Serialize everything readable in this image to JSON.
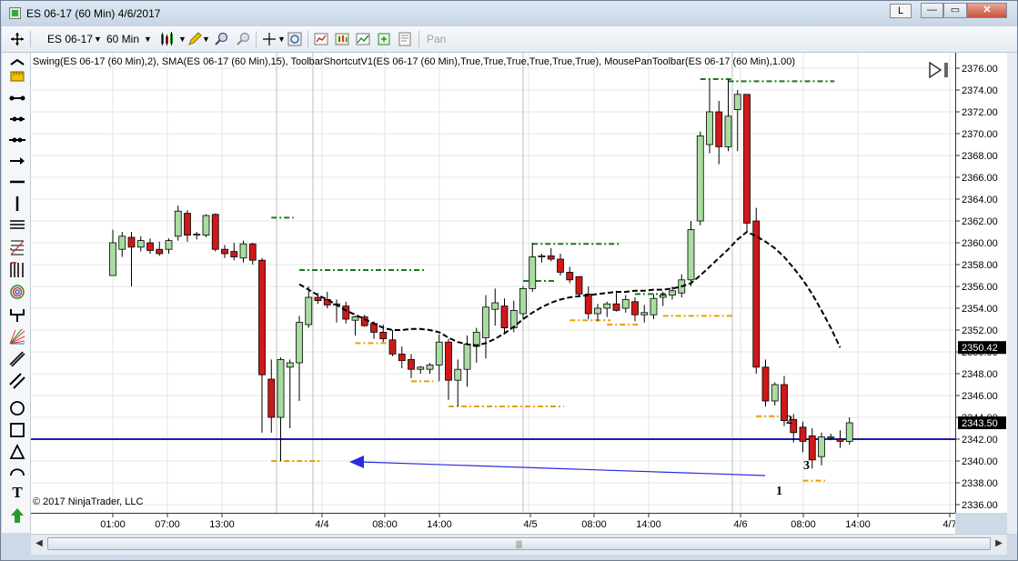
{
  "window": {
    "title": "ES 06-17 (60 Min)  4/6/2017",
    "layout_button": "L",
    "minimize": "—",
    "maximize": "▭",
    "close": "✕"
  },
  "toolbar": {
    "instrument": "ES 06-17",
    "interval": "60 Min",
    "pan_label": "Pan"
  },
  "chart_header": {
    "indicators": "Swing(ES 06-17 (60 Min),2), SMA(ES 06-17 (60 Min),15), ToolbarShortcutV1(ES 06-17 (60 Min),True,True,True,True,True,True), MousePanToolbar(ES 06-17 (60 Min),1.00)",
    "copyright": "© 2017 NinjaTrader, LLC"
  },
  "price_axis": {
    "ticks": [
      "2376.00",
      "2374.00",
      "2372.00",
      "2370.00",
      "2368.00",
      "2366.00",
      "2364.00",
      "2362.00",
      "2360.00",
      "2358.00",
      "2356.00",
      "2354.00",
      "2352.00",
      "2350.00",
      "2348.00",
      "2346.00",
      "2344.00",
      "2342.00",
      "2340.00",
      "2338.00",
      "2336.00"
    ],
    "current_price_label": "2350.42",
    "hline_label": "2343.50"
  },
  "time_axis": {
    "labels": [
      "01:00",
      "07:00",
      "13:00",
      "4/4",
      "08:00",
      "14:00",
      "4/5",
      "08:00",
      "14:00",
      "4/6",
      "08:00",
      "14:00",
      "4/7"
    ]
  },
  "annotations": {
    "label_1": "1",
    "label_2": "2",
    "label_3": "3"
  },
  "colors": {
    "up_candle": "#a8dca0",
    "down_candle": "#d01818",
    "sma": "#000000",
    "swing_high": "#1a7a1a",
    "swing_low": "#e8a000",
    "hline": "#1c1ca8",
    "arrow": "#2a2ae0"
  },
  "chart_data": {
    "type": "candlestick",
    "instrument": "ES 06-17",
    "interval": "60 Min",
    "ylim": [
      2336,
      2377
    ],
    "candles": [
      {
        "o": 2357.0,
        "h": 2361.2,
        "l": 2357.0,
        "c": 2360.0
      },
      {
        "o": 2359.4,
        "h": 2361.0,
        "l": 2358.7,
        "c": 2360.6
      },
      {
        "o": 2360.5,
        "h": 2361.0,
        "l": 2356.0,
        "c": 2359.6
      },
      {
        "o": 2359.6,
        "h": 2360.6,
        "l": 2359.2,
        "c": 2360.2
      },
      {
        "o": 2360.0,
        "h": 2360.4,
        "l": 2359.0,
        "c": 2359.3
      },
      {
        "o": 2359.4,
        "h": 2360.1,
        "l": 2358.8,
        "c": 2359.0
      },
      {
        "o": 2359.4,
        "h": 2360.4,
        "l": 2359.0,
        "c": 2360.2
      },
      {
        "o": 2360.6,
        "h": 2363.4,
        "l": 2360.2,
        "c": 2362.9
      },
      {
        "o": 2362.7,
        "h": 2363.0,
        "l": 2360.1,
        "c": 2360.7
      },
      {
        "o": 2360.7,
        "h": 2361.0,
        "l": 2360.3,
        "c": 2360.8
      },
      {
        "o": 2360.7,
        "h": 2362.6,
        "l": 2360.5,
        "c": 2362.5
      },
      {
        "o": 2362.6,
        "h": 2362.7,
        "l": 2359.2,
        "c": 2359.4
      },
      {
        "o": 2359.4,
        "h": 2359.8,
        "l": 2358.6,
        "c": 2359.0
      },
      {
        "o": 2359.2,
        "h": 2360.0,
        "l": 2358.4,
        "c": 2358.7
      },
      {
        "o": 2358.6,
        "h": 2360.2,
        "l": 2358.2,
        "c": 2359.9
      },
      {
        "o": 2359.9,
        "h": 2360.0,
        "l": 2358.0,
        "c": 2358.4
      },
      {
        "o": 2358.4,
        "h": 2358.6,
        "l": 2342.6,
        "c": 2347.9
      },
      {
        "o": 2347.5,
        "h": 2349.3,
        "l": 2342.6,
        "c": 2344.0
      },
      {
        "o": 2344.0,
        "h": 2349.5,
        "l": 2340.0,
        "c": 2349.3
      },
      {
        "o": 2348.6,
        "h": 2349.3,
        "l": 2343.0,
        "c": 2349.0
      },
      {
        "o": 2349.0,
        "h": 2353.3,
        "l": 2345.5,
        "c": 2352.7
      },
      {
        "o": 2352.5,
        "h": 2356.0,
        "l": 2352.2,
        "c": 2355.0
      },
      {
        "o": 2355.0,
        "h": 2355.4,
        "l": 2354.4,
        "c": 2354.7
      },
      {
        "o": 2354.8,
        "h": 2355.5,
        "l": 2354.0,
        "c": 2354.3
      },
      {
        "o": 2354.3,
        "h": 2354.8,
        "l": 2352.7,
        "c": 2354.4
      },
      {
        "o": 2354.2,
        "h": 2354.6,
        "l": 2352.6,
        "c": 2353.0
      },
      {
        "o": 2352.9,
        "h": 2353.3,
        "l": 2351.5,
        "c": 2353.2
      },
      {
        "o": 2353.2,
        "h": 2353.4,
        "l": 2352.3,
        "c": 2352.4
      },
      {
        "o": 2352.6,
        "h": 2352.8,
        "l": 2351.2,
        "c": 2351.8
      },
      {
        "o": 2351.8,
        "h": 2352.5,
        "l": 2350.9,
        "c": 2351.2
      },
      {
        "o": 2351.1,
        "h": 2352.0,
        "l": 2349.6,
        "c": 2349.8
      },
      {
        "o": 2349.8,
        "h": 2350.5,
        "l": 2348.5,
        "c": 2349.2
      },
      {
        "o": 2349.3,
        "h": 2349.8,
        "l": 2347.6,
        "c": 2348.4
      },
      {
        "o": 2348.4,
        "h": 2348.7,
        "l": 2348.0,
        "c": 2348.6
      },
      {
        "o": 2348.4,
        "h": 2349.0,
        "l": 2348.0,
        "c": 2348.8
      },
      {
        "o": 2348.8,
        "h": 2351.6,
        "l": 2347.3,
        "c": 2350.9
      },
      {
        "o": 2350.9,
        "h": 2351.2,
        "l": 2345.6,
        "c": 2347.4
      },
      {
        "o": 2347.4,
        "h": 2349.3,
        "l": 2345.0,
        "c": 2348.4
      },
      {
        "o": 2348.4,
        "h": 2351.5,
        "l": 2346.8,
        "c": 2350.7
      },
      {
        "o": 2350.5,
        "h": 2352.2,
        "l": 2349.0,
        "c": 2351.8
      },
      {
        "o": 2351.3,
        "h": 2355.2,
        "l": 2349.4,
        "c": 2354.1
      },
      {
        "o": 2353.9,
        "h": 2355.8,
        "l": 2352.4,
        "c": 2354.5
      },
      {
        "o": 2354.2,
        "h": 2354.9,
        "l": 2351.8,
        "c": 2352.2
      },
      {
        "o": 2352.2,
        "h": 2354.7,
        "l": 2351.8,
        "c": 2353.8
      },
      {
        "o": 2353.5,
        "h": 2356.0,
        "l": 2353.0,
        "c": 2355.8
      },
      {
        "o": 2355.8,
        "h": 2360.0,
        "l": 2355.5,
        "c": 2358.7
      },
      {
        "o": 2358.7,
        "h": 2359.0,
        "l": 2358.2,
        "c": 2358.8
      },
      {
        "o": 2358.8,
        "h": 2359.5,
        "l": 2358.3,
        "c": 2358.5
      },
      {
        "o": 2358.5,
        "h": 2359.0,
        "l": 2357.0,
        "c": 2357.3
      },
      {
        "o": 2357.3,
        "h": 2357.8,
        "l": 2356.3,
        "c": 2356.6
      },
      {
        "o": 2356.9,
        "h": 2356.6,
        "l": 2355.0,
        "c": 2355.3
      },
      {
        "o": 2355.3,
        "h": 2356.0,
        "l": 2353.0,
        "c": 2353.5
      },
      {
        "o": 2353.5,
        "h": 2354.4,
        "l": 2352.8,
        "c": 2354.0
      },
      {
        "o": 2354.0,
        "h": 2354.6,
        "l": 2353.2,
        "c": 2354.4
      },
      {
        "o": 2354.4,
        "h": 2355.6,
        "l": 2353.7,
        "c": 2353.8
      },
      {
        "o": 2354.0,
        "h": 2355.2,
        "l": 2353.6,
        "c": 2354.8
      },
      {
        "o": 2354.6,
        "h": 2355.0,
        "l": 2352.8,
        "c": 2353.4
      },
      {
        "o": 2353.4,
        "h": 2354.3,
        "l": 2352.7,
        "c": 2353.6
      },
      {
        "o": 2353.4,
        "h": 2355.3,
        "l": 2353.0,
        "c": 2354.9
      },
      {
        "o": 2355.0,
        "h": 2355.5,
        "l": 2354.2,
        "c": 2355.2
      },
      {
        "o": 2355.2,
        "h": 2356.0,
        "l": 2354.8,
        "c": 2355.6
      },
      {
        "o": 2355.4,
        "h": 2357.1,
        "l": 2355.0,
        "c": 2356.6
      },
      {
        "o": 2356.6,
        "h": 2362.0,
        "l": 2356.0,
        "c": 2361.2
      },
      {
        "o": 2362.0,
        "h": 2370.2,
        "l": 2361.6,
        "c": 2369.8
      },
      {
        "o": 2369.0,
        "h": 2375.0,
        "l": 2368.2,
        "c": 2372.0
      },
      {
        "o": 2372.0,
        "h": 2373.0,
        "l": 2367.2,
        "c": 2368.8
      },
      {
        "o": 2368.8,
        "h": 2375.0,
        "l": 2368.4,
        "c": 2371.6
      },
      {
        "o": 2372.2,
        "h": 2374.0,
        "l": 2368.4,
        "c": 2373.6
      },
      {
        "o": 2373.6,
        "h": 2373.6,
        "l": 2361.0,
        "c": 2361.8
      },
      {
        "o": 2362.0,
        "h": 2363.2,
        "l": 2348.0,
        "c": 2348.6
      },
      {
        "o": 2348.6,
        "h": 2349.3,
        "l": 2345.0,
        "c": 2345.5
      },
      {
        "o": 2345.5,
        "h": 2347.2,
        "l": 2345.1,
        "c": 2347.0
      },
      {
        "o": 2347.0,
        "h": 2347.8,
        "l": 2343.2,
        "c": 2343.7
      },
      {
        "o": 2343.8,
        "h": 2344.3,
        "l": 2341.7,
        "c": 2342.6
      },
      {
        "o": 2343.1,
        "h": 2343.6,
        "l": 2340.8,
        "c": 2341.8
      },
      {
        "o": 2342.3,
        "h": 2343.0,
        "l": 2339.3,
        "c": 2340.1
      },
      {
        "o": 2340.4,
        "h": 2342.6,
        "l": 2339.6,
        "c": 2342.2
      },
      {
        "o": 2342.1,
        "h": 2342.5,
        "l": 2341.9,
        "c": 2342.2
      },
      {
        "o": 2342.0,
        "h": 2342.8,
        "l": 2341.2,
        "c": 2341.8
      },
      {
        "o": 2341.8,
        "h": 2344.0,
        "l": 2341.5,
        "c": 2343.5
      }
    ],
    "sma_period": 15,
    "sma": [
      {
        "i": 20,
        "v": 2356.2
      },
      {
        "i": 21,
        "v": 2355.7
      },
      {
        "i": 22,
        "v": 2355.2
      },
      {
        "i": 23,
        "v": 2354.8
      },
      {
        "i": 24,
        "v": 2354.3
      },
      {
        "i": 25,
        "v": 2353.8
      },
      {
        "i": 26,
        "v": 2353.4
      },
      {
        "i": 27,
        "v": 2353.0
      },
      {
        "i": 28,
        "v": 2352.6
      },
      {
        "i": 29,
        "v": 2352.2
      },
      {
        "i": 30,
        "v": 2352.0
      },
      {
        "i": 31,
        "v": 2352.0
      },
      {
        "i": 32,
        "v": 2352.1
      },
      {
        "i": 33,
        "v": 2352.1
      },
      {
        "i": 34,
        "v": 2352.0
      },
      {
        "i": 35,
        "v": 2351.8
      },
      {
        "i": 36,
        "v": 2351.3
      },
      {
        "i": 37,
        "v": 2350.9
      },
      {
        "i": 38,
        "v": 2350.7
      },
      {
        "i": 39,
        "v": 2350.6
      },
      {
        "i": 40,
        "v": 2350.8
      },
      {
        "i": 41,
        "v": 2351.2
      },
      {
        "i": 42,
        "v": 2351.7
      },
      {
        "i": 43,
        "v": 2352.3
      },
      {
        "i": 44,
        "v": 2353.0
      },
      {
        "i": 45,
        "v": 2353.6
      },
      {
        "i": 46,
        "v": 2354.1
      },
      {
        "i": 47,
        "v": 2354.5
      },
      {
        "i": 48,
        "v": 2354.8
      },
      {
        "i": 49,
        "v": 2355.0
      },
      {
        "i": 50,
        "v": 2355.1
      },
      {
        "i": 51,
        "v": 2355.2
      },
      {
        "i": 52,
        "v": 2355.3
      },
      {
        "i": 53,
        "v": 2355.4
      },
      {
        "i": 54,
        "v": 2355.5
      },
      {
        "i": 55,
        "v": 2355.5
      },
      {
        "i": 56,
        "v": 2355.6
      },
      {
        "i": 57,
        "v": 2355.6
      },
      {
        "i": 58,
        "v": 2355.7
      },
      {
        "i": 59,
        "v": 2355.7
      },
      {
        "i": 60,
        "v": 2355.8
      },
      {
        "i": 61,
        "v": 2356.0
      },
      {
        "i": 62,
        "v": 2356.3
      },
      {
        "i": 63,
        "v": 2357.0
      },
      {
        "i": 64,
        "v": 2357.8
      },
      {
        "i": 65,
        "v": 2358.6
      },
      {
        "i": 66,
        "v": 2359.4
      },
      {
        "i": 67,
        "v": 2360.3
      },
      {
        "i": 68,
        "v": 2361.0
      },
      {
        "i": 69,
        "v": 2360.6
      },
      {
        "i": 70,
        "v": 2360.1
      },
      {
        "i": 71,
        "v": 2359.5
      },
      {
        "i": 72,
        "v": 2358.7
      },
      {
        "i": 73,
        "v": 2357.7
      },
      {
        "i": 74,
        "v": 2356.6
      },
      {
        "i": 75,
        "v": 2355.3
      },
      {
        "i": 76,
        "v": 2353.8
      },
      {
        "i": 77,
        "v": 2352.2
      },
      {
        "i": 78,
        "v": 2350.4
      }
    ],
    "swing_highs": [
      {
        "from": 17,
        "to": 19,
        "v": 2362.3
      },
      {
        "from": 20,
        "to": 33,
        "v": 2357.5
      },
      {
        "from": 44,
        "to": 47,
        "v": 2356.5
      },
      {
        "from": 45,
        "to": 54,
        "v": 2359.9
      },
      {
        "from": 56,
        "to": 59,
        "v": 2355.3
      },
      {
        "from": 63,
        "to": 66,
        "v": 2375.0
      },
      {
        "from": 66,
        "to": 77,
        "v": 2374.8
      }
    ],
    "swing_lows": [
      {
        "from": 17,
        "to": 22,
        "v": 2340.0
      },
      {
        "from": 26,
        "to": 29,
        "v": 2350.8
      },
      {
        "from": 32,
        "to": 34,
        "v": 2347.3
      },
      {
        "from": 36,
        "to": 48,
        "v": 2345.0
      },
      {
        "from": 49,
        "to": 53,
        "v": 2352.9
      },
      {
        "from": 53,
        "to": 56,
        "v": 2352.5
      },
      {
        "from": 59,
        "to": 66,
        "v": 2353.3
      },
      {
        "from": 69,
        "to": 71,
        "v": 2344.1
      },
      {
        "from": 74,
        "to": 76,
        "v": 2338.2
      }
    ],
    "hline": 2342.0
  }
}
